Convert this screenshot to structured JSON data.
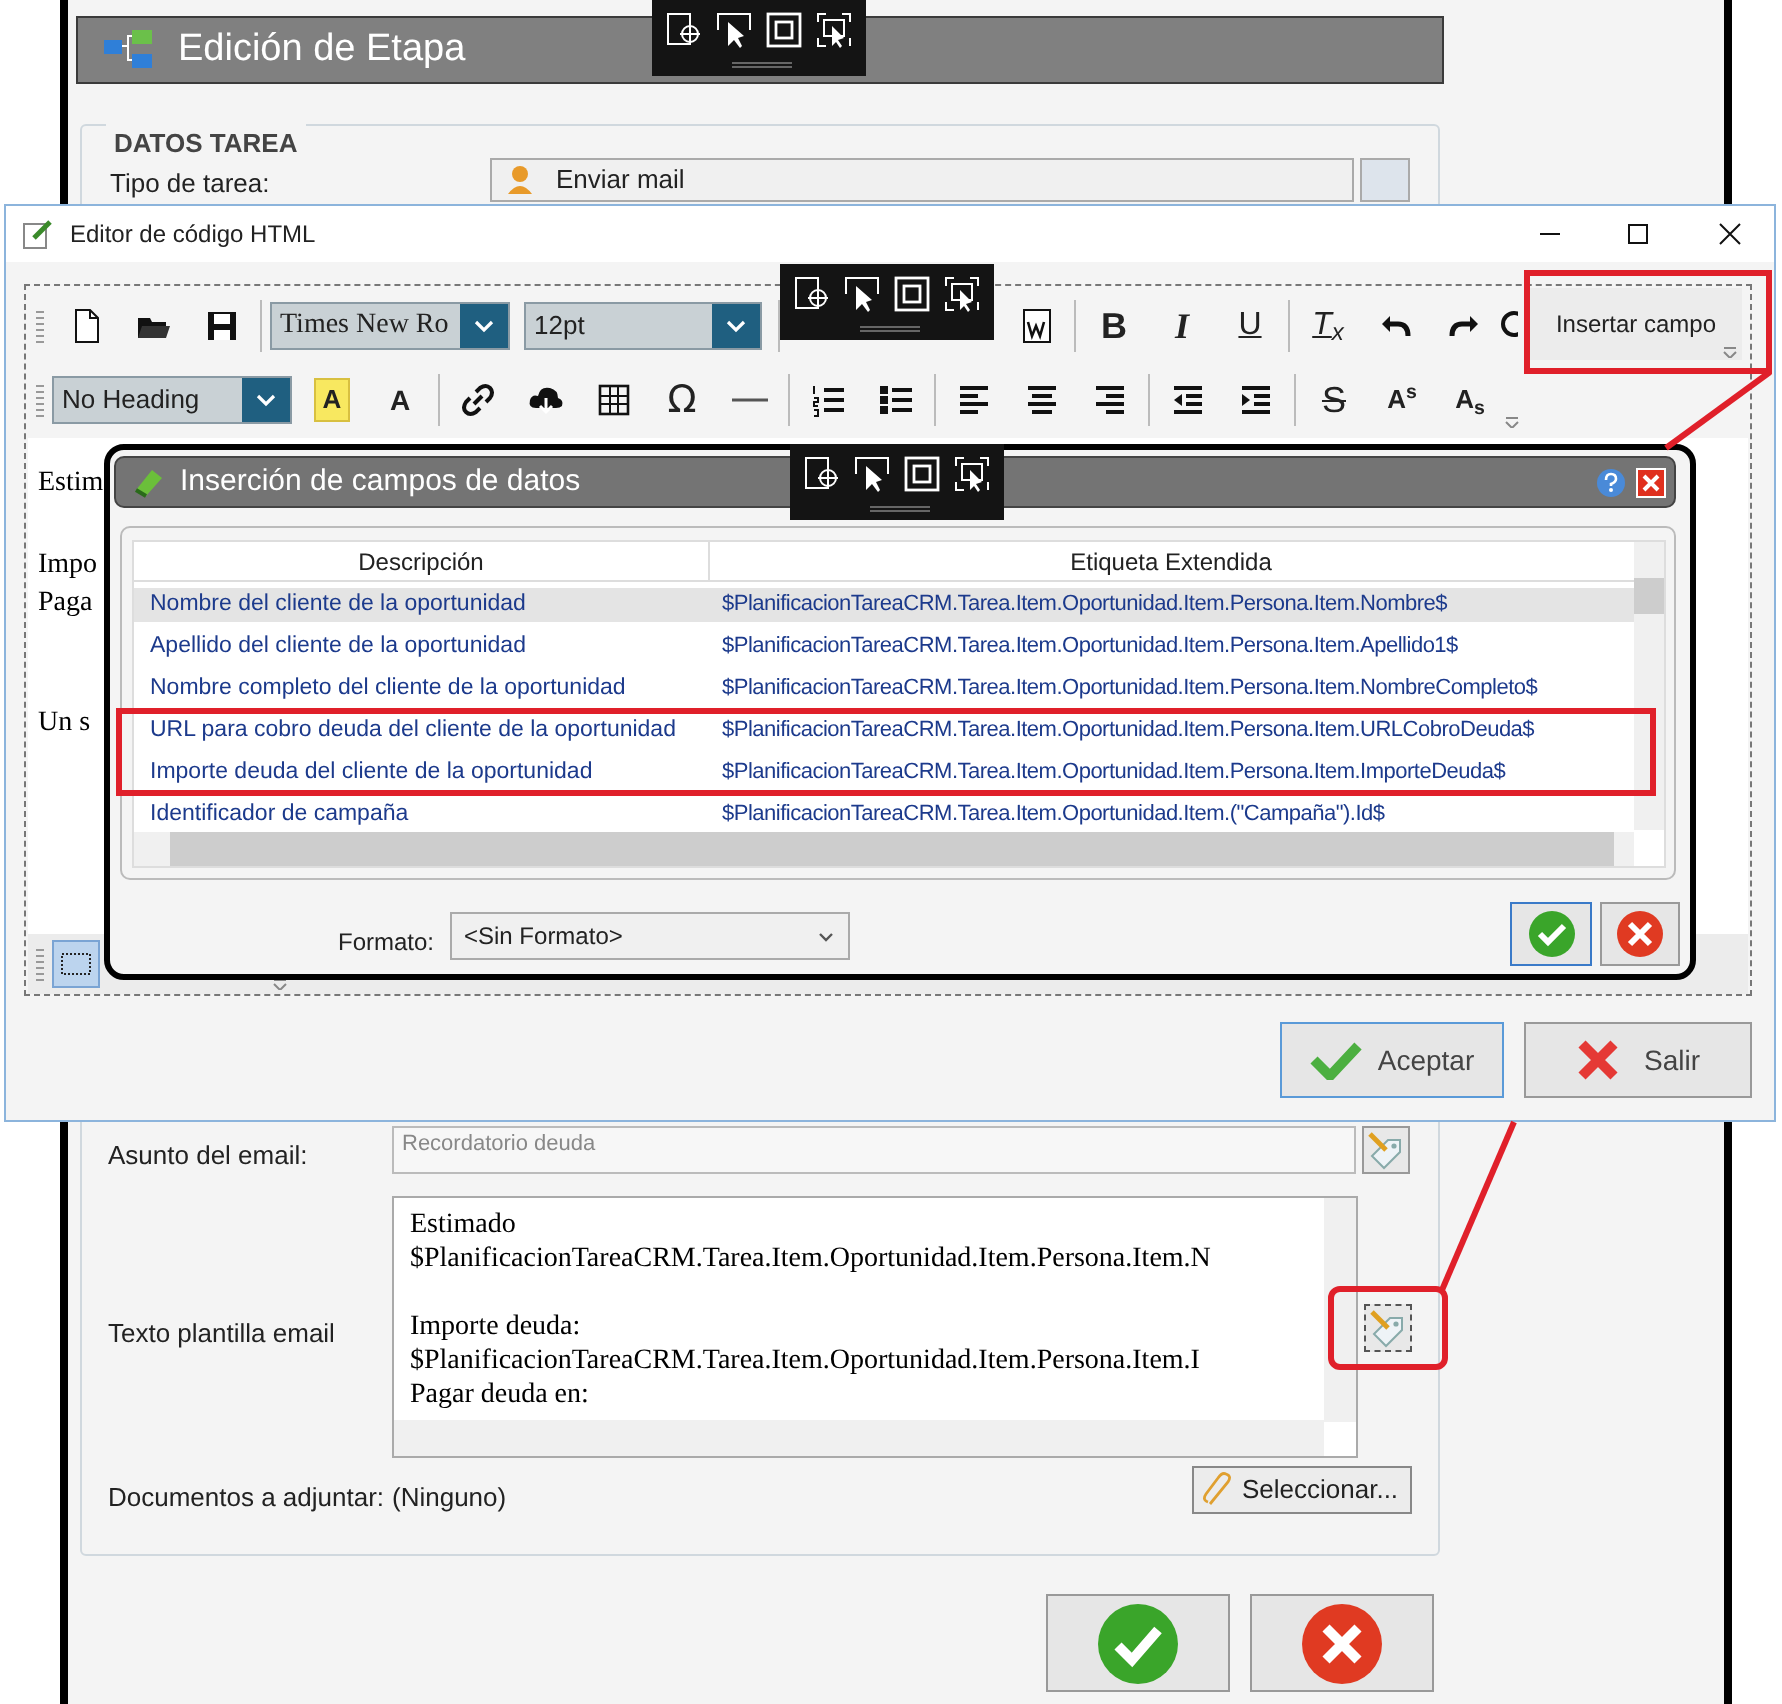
{
  "main_window": {
    "title": "Edición de Etapa",
    "section": "DATOS TAREA",
    "task_type": {
      "label": "Tipo de tarea:",
      "value": "Enviar mail"
    },
    "subject": {
      "label": "Asunto del email:",
      "placeholder": "Recordatorio deuda"
    },
    "template": {
      "label": "Texto plantilla email",
      "paragraphs": [
        [
          "Estimado",
          "$PlanificacionTareaCRM.Tarea.Item.Oportunidad.Item.Persona.Item.N"
        ],
        [
          "Importe deuda:",
          "$PlanificacionTareaCRM.Tarea.Item.Oportunidad.Item.Persona.Item.I",
          "Pagar deuda en:"
        ]
      ]
    },
    "attachments": {
      "label": "Documentos a adjuntar:",
      "value": "(Ninguno)"
    },
    "select_button": "Seleccionar..."
  },
  "editor_window": {
    "title": "Editor de código HTML",
    "font": "Times New Ro",
    "size": "12pt",
    "heading": "No Heading",
    "glyphs": [
      "B",
      "I",
      "U",
      "T$_{x}$",
      "A",
      "A",
      "Ω",
      "S",
      "A$^{s}$",
      "A$_{s}$"
    ],
    "insert_field": "Insertar campo",
    "content_lines": [
      "Estim",
      "Impo",
      "Paga",
      "Un s"
    ],
    "buttons": [
      "Aceptar",
      "Salir"
    ]
  },
  "fields_dialog": {
    "title": "Inserción de campos de datos",
    "columns": [
      "Descripción",
      "Etiqueta Extendida"
    ],
    "rows": [
      {
        "description": "Nombre del cliente de la oportunidad",
        "tag": "$PlanificacionTareaCRM.Tarea.Item.Oportunidad.Item.Persona.Item.Nombre$",
        "selected": true
      },
      {
        "description": "Apellido del cliente de la oportunidad",
        "tag": "$PlanificacionTareaCRM.Tarea.Item.Oportunidad.Item.Persona.Item.Apellido1$",
        "selected": false
      },
      {
        "description": "Nombre completo del cliente de la oportunidad",
        "tag": "$PlanificacionTareaCRM.Tarea.Item.Oportunidad.Item.Persona.Item.NombreCompleto$",
        "selected": false
      },
      {
        "description": "URL para cobro deuda del cliente de la oportunidad",
        "tag": "$PlanificacionTareaCRM.Tarea.Item.Oportunidad.Item.Persona.Item.URLCobroDeuda$",
        "selected": false
      },
      {
        "description": "Importe deuda del cliente de la oportunidad",
        "tag": "$PlanificacionTareaCRM.Tarea.Item.Oportunidad.Item.Persona.Item.ImporteDeuda$",
        "selected": false
      },
      {
        "description": "Identificador de campaña",
        "tag": "$PlanificacionTareaCRM.Tarea.Item.Oportunidad.Item.(\"Campaña\").Id$",
        "selected": false
      }
    ],
    "format": {
      "label": "Formato:",
      "value": "<Sin Formato>"
    }
  }
}
